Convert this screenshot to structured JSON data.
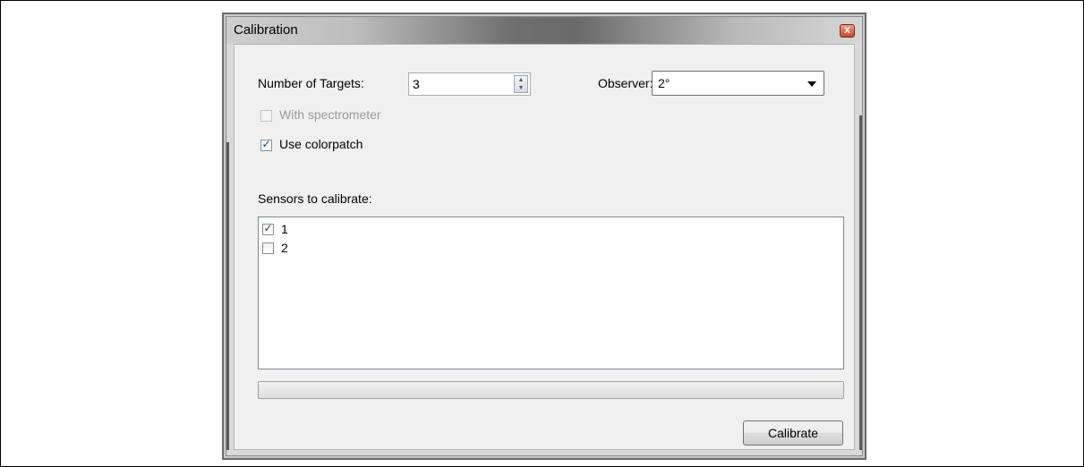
{
  "window": {
    "title": "Calibration",
    "close_symbol": "x"
  },
  "form": {
    "targets_label": "Number of Targets:",
    "targets_value": "3",
    "observer_label": "Observer:",
    "observer_value": "2°",
    "with_spectrometer": {
      "label": "With spectrometer",
      "checked": false,
      "enabled": false
    },
    "use_colorpatch": {
      "label": "Use colorpatch",
      "checked": true,
      "enabled": true
    },
    "sensors_label": "Sensors to calibrate:",
    "sensors": [
      {
        "label": "1",
        "checked": true
      },
      {
        "label": "2",
        "checked": false
      }
    ],
    "progress_percent": 0,
    "calibrate_label": "Calibrate"
  },
  "icons": {
    "check": "✓",
    "spin_up": "▲",
    "spin_down": "▼"
  }
}
